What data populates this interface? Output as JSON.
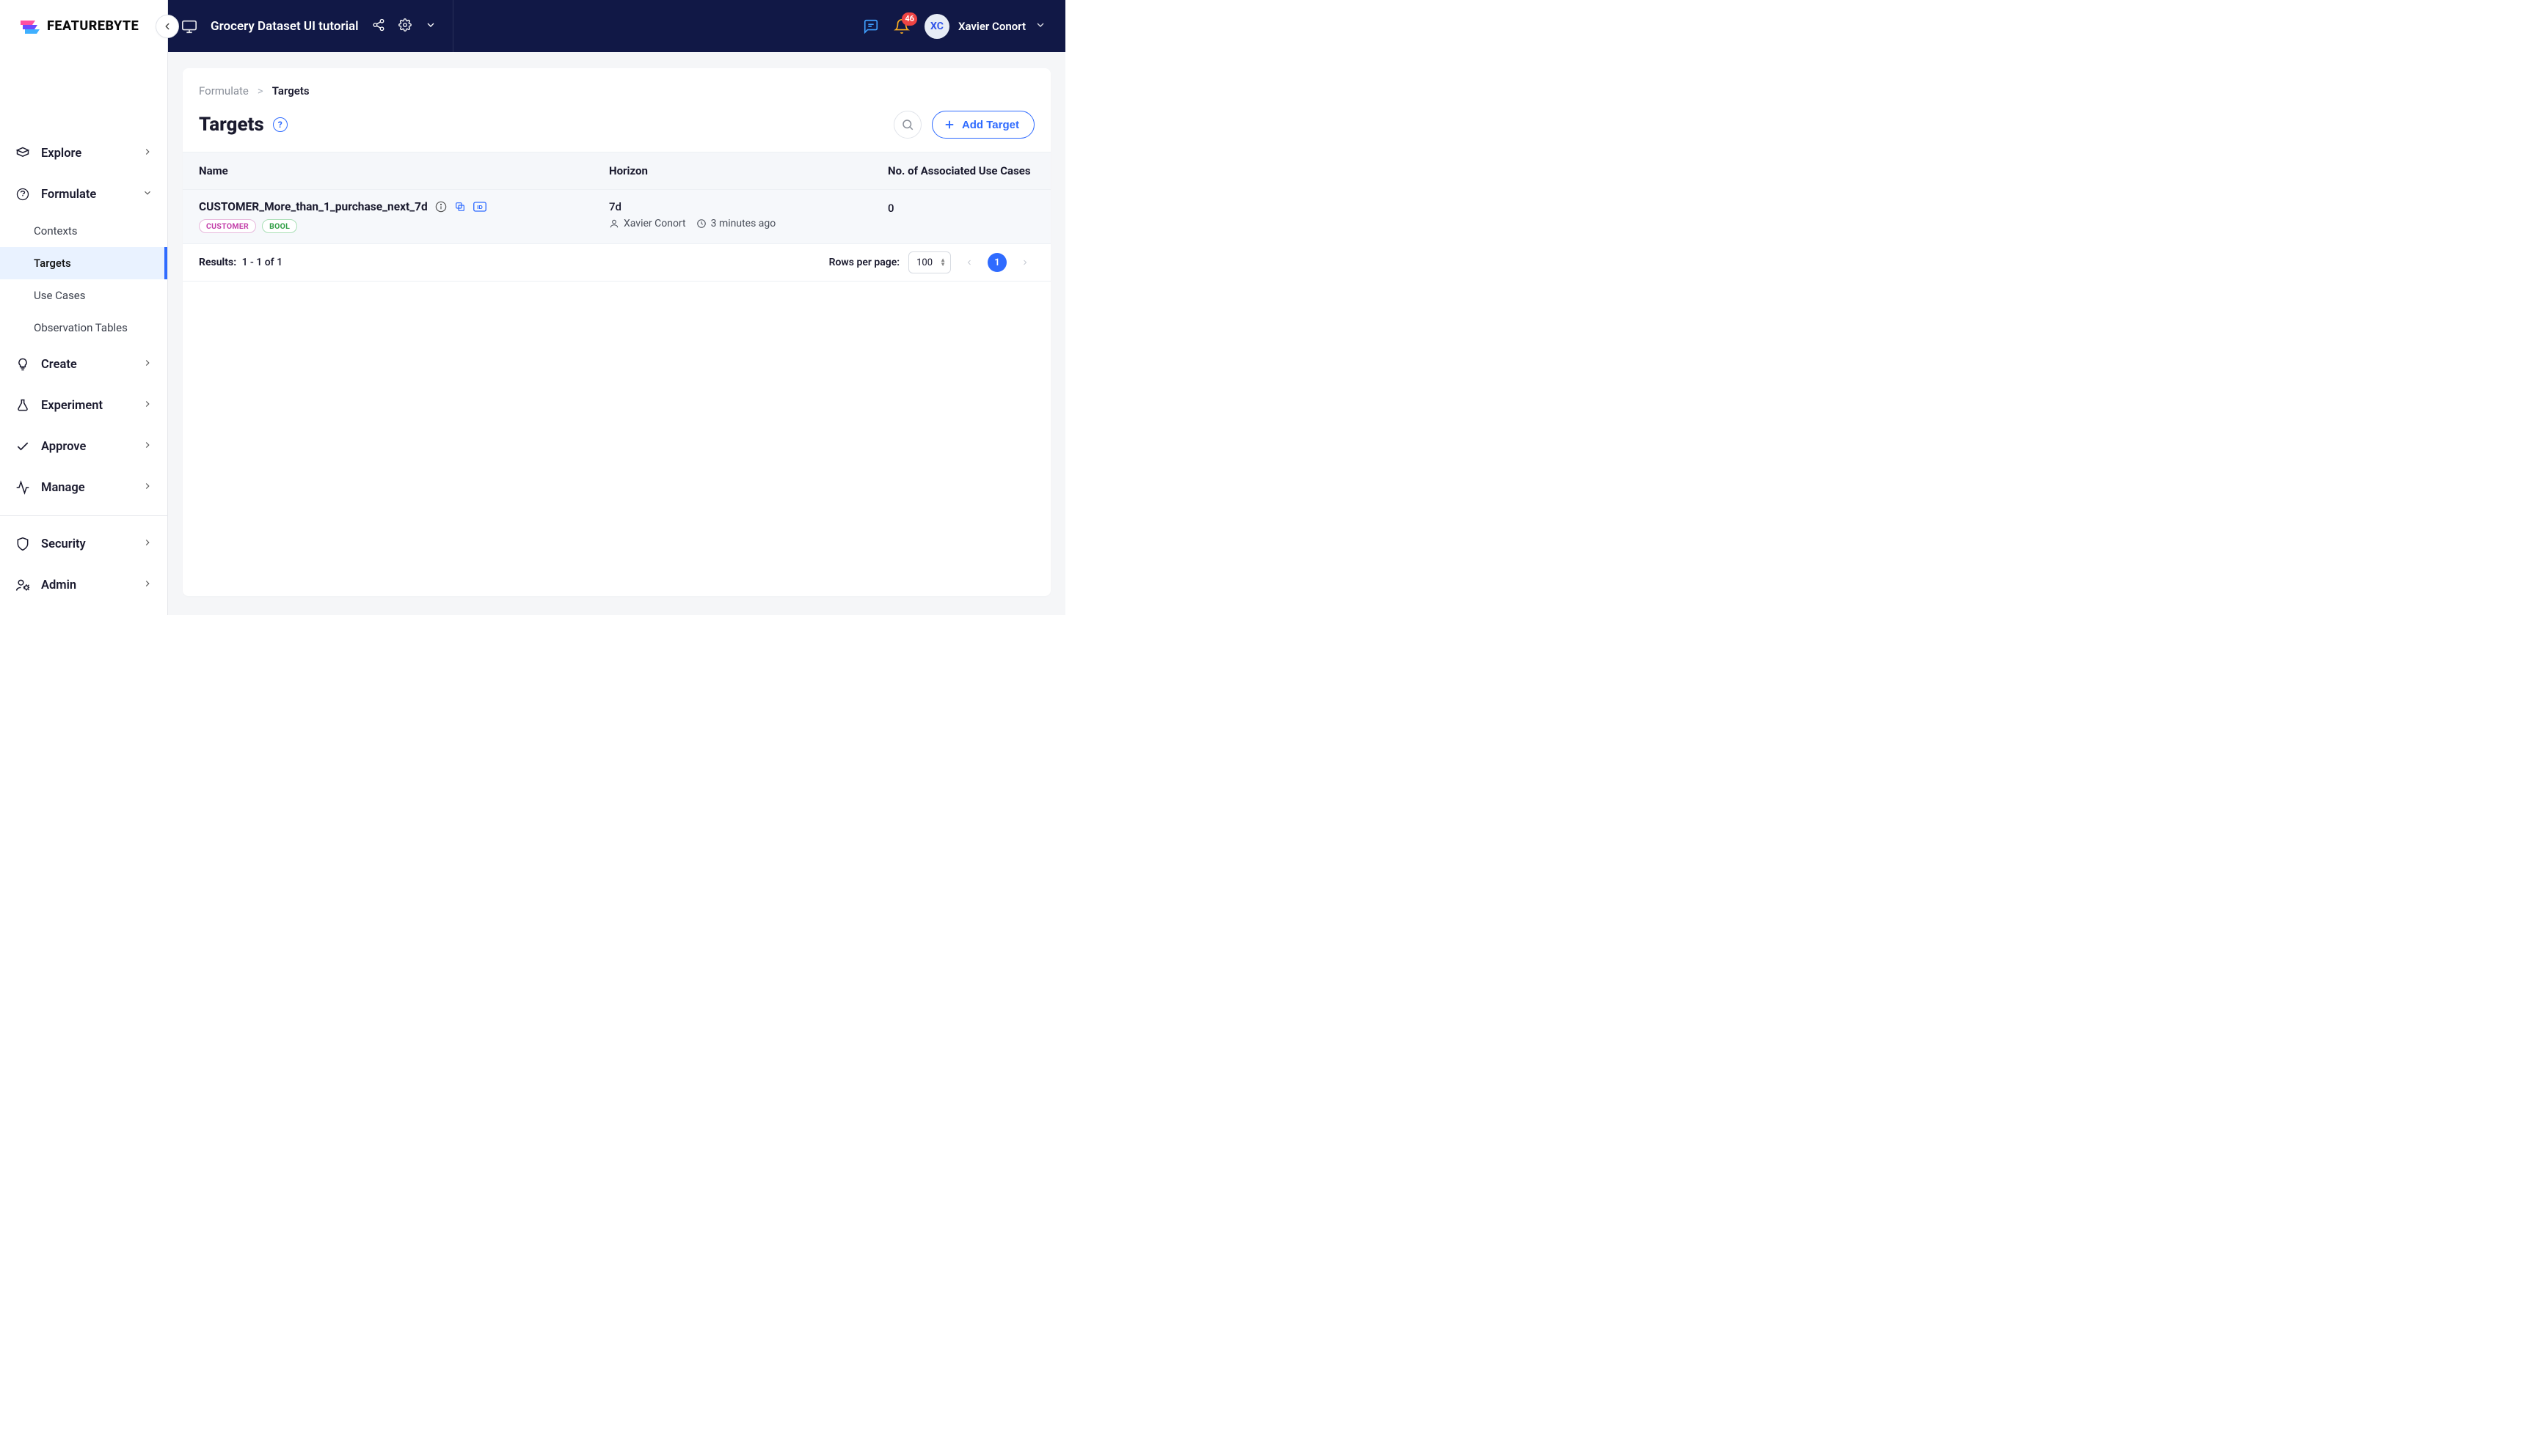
{
  "brand": {
    "name": "FEATUREBYTE"
  },
  "topbar": {
    "project_name": "Grocery Dataset UI tutorial",
    "notifications_count": "46",
    "user_initials": "XC",
    "user_name": "Xavier Conort"
  },
  "sidebar": {
    "items": [
      {
        "label": "Explore"
      },
      {
        "label": "Formulate"
      },
      {
        "label": "Create"
      },
      {
        "label": "Experiment"
      },
      {
        "label": "Approve"
      },
      {
        "label": "Manage"
      },
      {
        "label": "Security"
      },
      {
        "label": "Admin"
      }
    ],
    "formulate_sub": [
      {
        "label": "Contexts"
      },
      {
        "label": "Targets"
      },
      {
        "label": "Use Cases"
      },
      {
        "label": "Observation Tables"
      }
    ]
  },
  "breadcrumb": {
    "root": "Formulate",
    "current": "Targets"
  },
  "page": {
    "title": "Targets",
    "add_button_label": "Add Target"
  },
  "table": {
    "columns": {
      "name": "Name",
      "horizon": "Horizon",
      "usecases": "No. of Associated Use Cases"
    },
    "rows": [
      {
        "name": "CUSTOMER_More_than_1_purchase_next_7d",
        "tags": {
          "entity": "CUSTOMER",
          "dtype": "BOOL"
        },
        "horizon_value": "7d",
        "author": "Xavier Conort",
        "age": "3 minutes ago",
        "usecase_count": "0"
      }
    ],
    "footer": {
      "results_label": "Results:",
      "results_range": "1 - 1 of 1",
      "rows_per_page_label": "Rows per page:",
      "rows_per_page_value": "100",
      "current_page": "1"
    }
  }
}
